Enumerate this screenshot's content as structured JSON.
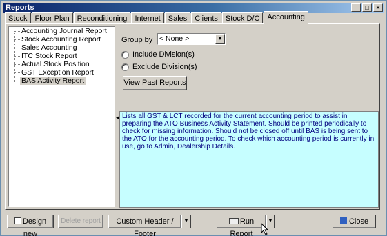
{
  "window": {
    "title": "Reports"
  },
  "tabs": [
    "Stock",
    "Floor Plan",
    "Reconditioning",
    "Internet",
    "Sales",
    "Clients",
    "Stock D/C",
    "Accounting"
  ],
  "active_tab": "Accounting",
  "report_list": {
    "items": [
      "Accounting Journal Report",
      "Stock Accounting Report",
      "Sales Accounting",
      "ITC Stock Report",
      "Actual Stock Position",
      "GST Exception Report",
      "BAS Activity Report"
    ],
    "selected": "BAS Activity Report"
  },
  "options": {
    "group_by_label": "Group by",
    "group_by_value": "< None >",
    "include_divisions": "Include Division(s)",
    "exclude_divisions": "Exclude Division(s)",
    "view_past_reports": "View Past Reports"
  },
  "description": "Lists all GST & LCT recorded for the current accounting period to assist in preparing the ATO Business Activity Statement.  Should be printed periodically to check for missing information.  Should not be closed off until BAS is being sent to the ATO for the accounting period.  To check which accounting period is currently in use, go to Admin, Dealership Details.",
  "bottom": {
    "design_new": "Design new",
    "delete_report": "Delete report",
    "custom_header_footer": "Custom Header / Footer",
    "run_report": "Run Report",
    "close": "Close"
  },
  "colors": {
    "title_bar": "#0a246a",
    "description_bg": "#c6feff",
    "description_text": "#000080"
  }
}
